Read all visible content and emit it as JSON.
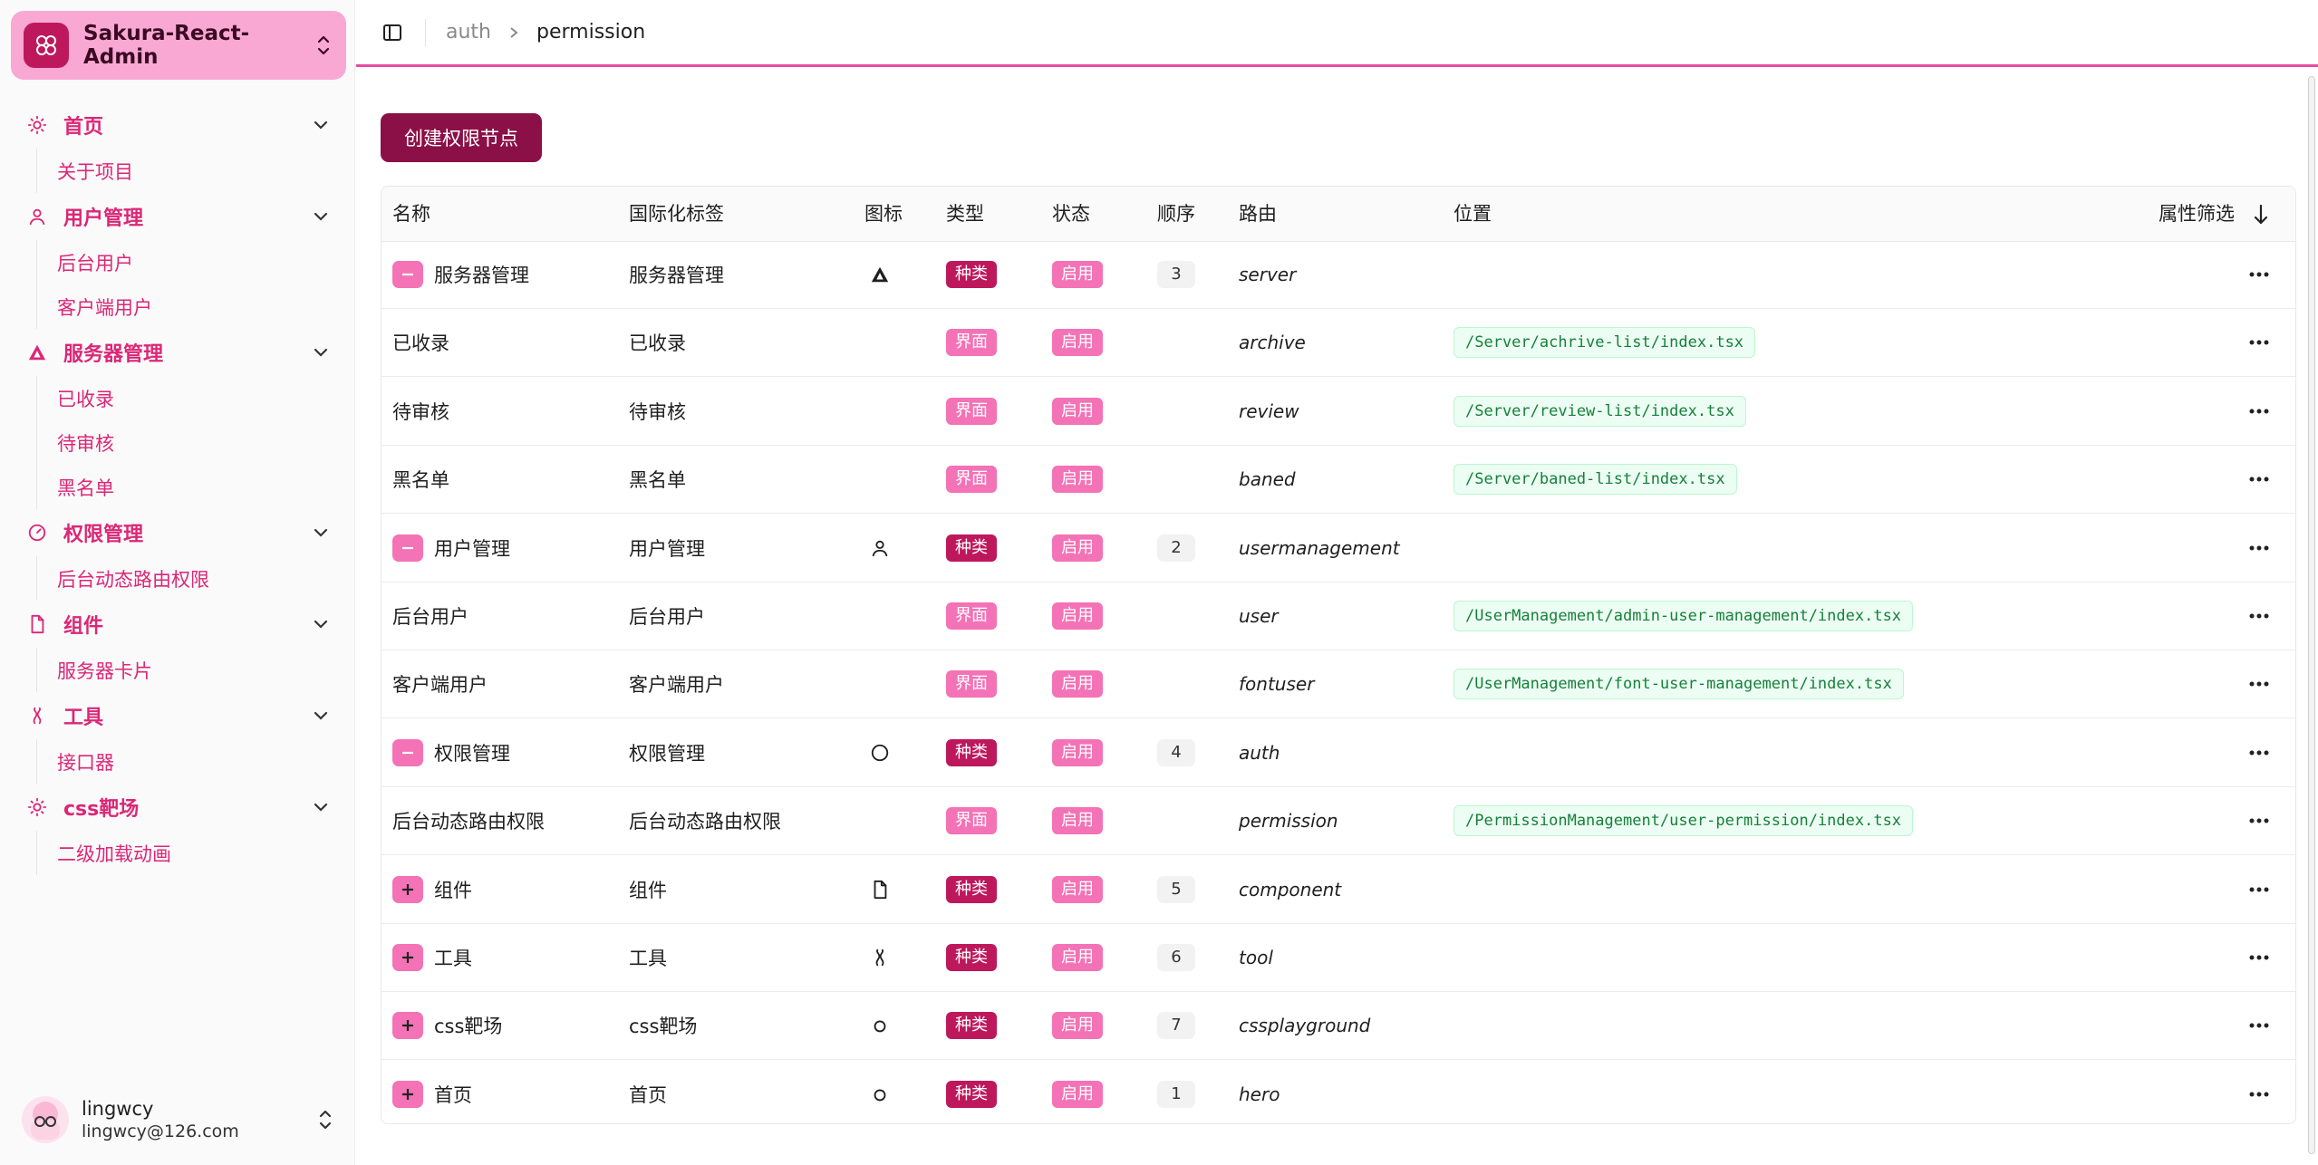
{
  "app": {
    "name": "Sakura-React-Admin"
  },
  "nav": [
    {
      "group": "首页",
      "icon": "sun-icon",
      "items": [
        "关于项目"
      ]
    },
    {
      "group": "用户管理",
      "icon": "user-icon",
      "items": [
        "后台用户",
        "客户端用户"
      ]
    },
    {
      "group": "服务器管理",
      "icon": "triangle-icon",
      "items": [
        "已收录",
        "待审核",
        "黑名单"
      ]
    },
    {
      "group": "权限管理",
      "icon": "gauge-icon",
      "items": [
        "后台动态路由权限"
      ]
    },
    {
      "group": "组件",
      "icon": "file-icon",
      "items": [
        "服务器卡片"
      ]
    },
    {
      "group": "工具",
      "icon": "tool-icon",
      "items": [
        "接口器"
      ]
    },
    {
      "group": "css靶场",
      "icon": "sun-icon",
      "items": [
        "二级加载动画"
      ]
    }
  ],
  "user": {
    "name": "lingwcy",
    "email": "lingwcy@126.com"
  },
  "breadcrumb": {
    "parent": "auth",
    "current": "permission"
  },
  "toolbar": {
    "create_label": "创建权限节点"
  },
  "table": {
    "headers": {
      "name": "名称",
      "i18n": "国际化标签",
      "icon": "图标",
      "type": "类型",
      "status": "状态",
      "order": "顺序",
      "route": "路由",
      "path": "位置",
      "filter": "属性筛选"
    },
    "rows": [
      {
        "toggle": "collapse",
        "name": "服务器管理",
        "i18n": "服务器管理",
        "icon": "triangle-icon",
        "type": "种类",
        "status": "启用",
        "order": "3",
        "route": "server",
        "path": ""
      },
      {
        "toggle": "",
        "name": "已收录",
        "i18n": "已收录",
        "icon": "",
        "type": "界面",
        "status": "启用",
        "order": "",
        "route": "archive",
        "path": "/Server/achrive-list/index.tsx"
      },
      {
        "toggle": "",
        "name": "待审核",
        "i18n": "待审核",
        "icon": "",
        "type": "界面",
        "status": "启用",
        "order": "",
        "route": "review",
        "path": "/Server/review-list/index.tsx"
      },
      {
        "toggle": "",
        "name": "黑名单",
        "i18n": "黑名单",
        "icon": "",
        "type": "界面",
        "status": "启用",
        "order": "",
        "route": "baned",
        "path": "/Server/baned-list/index.tsx"
      },
      {
        "toggle": "collapse",
        "name": "用户管理",
        "i18n": "用户管理",
        "icon": "user-icon",
        "type": "种类",
        "status": "启用",
        "order": "2",
        "route": "usermanagement",
        "path": ""
      },
      {
        "toggle": "",
        "name": "后台用户",
        "i18n": "后台用户",
        "icon": "",
        "type": "界面",
        "status": "启用",
        "order": "",
        "route": "user",
        "path": "/UserManagement/admin-user-management/index.tsx"
      },
      {
        "toggle": "",
        "name": "客户端用户",
        "i18n": "客户端用户",
        "icon": "",
        "type": "界面",
        "status": "启用",
        "order": "",
        "route": "fontuser",
        "path": "/UserManagement/font-user-management/index.tsx"
      },
      {
        "toggle": "collapse",
        "name": "权限管理",
        "i18n": "权限管理",
        "icon": "circle-icon",
        "type": "种类",
        "status": "启用",
        "order": "4",
        "route": "auth",
        "path": ""
      },
      {
        "toggle": "",
        "name": "后台动态路由权限",
        "i18n": "后台动态路由权限",
        "icon": "",
        "type": "界面",
        "status": "启用",
        "order": "",
        "route": "permission",
        "path": "/PermissionManagement/user-permission/index.tsx"
      },
      {
        "toggle": "expand",
        "name": "组件",
        "i18n": "组件",
        "icon": "file-icon",
        "type": "种类",
        "status": "启用",
        "order": "5",
        "route": "component",
        "path": ""
      },
      {
        "toggle": "expand",
        "name": "工具",
        "i18n": "工具",
        "icon": "tool-icon",
        "type": "种类",
        "status": "启用",
        "order": "6",
        "route": "tool",
        "path": ""
      },
      {
        "toggle": "expand",
        "name": "css靶场",
        "i18n": "css靶场",
        "icon": "small-circle-icon",
        "type": "种类",
        "status": "启用",
        "order": "7",
        "route": "cssplayground",
        "path": ""
      },
      {
        "toggle": "expand",
        "name": "首页",
        "i18n": "首页",
        "icon": "small-circle-icon",
        "type": "种类",
        "status": "启用",
        "order": "1",
        "route": "hero",
        "path": ""
      }
    ]
  },
  "colors": {
    "accent": "#db2777",
    "kind_tag": "#be185d",
    "page_tag": "#f472b6",
    "primary_button": "#8b1047"
  }
}
